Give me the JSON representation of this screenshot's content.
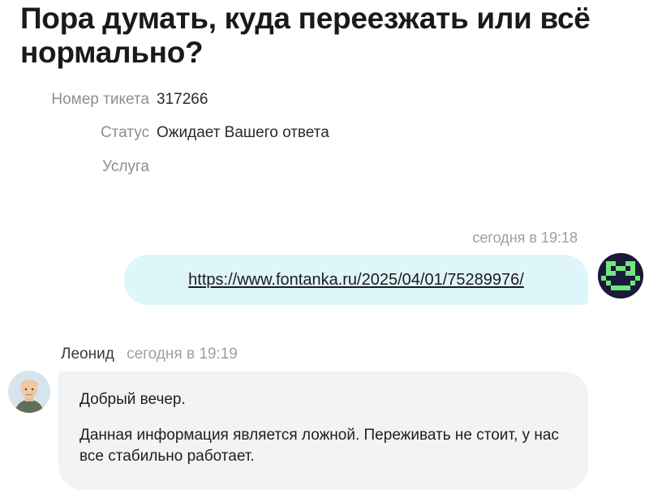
{
  "ticket": {
    "title": "Пора думать, куда переезжать или всё нормально?",
    "number_label": "Номер тикета",
    "number_value": "317266",
    "status_label": "Статус",
    "status_value": "Ожидает Вашего ответа",
    "service_label": "Услуга",
    "service_value": ""
  },
  "messages": {
    "user": {
      "time": "сегодня в 19:18",
      "link": "https://www.fontanka.ru/2025/04/01/75289976/",
      "avatar_icon": "pixel-smiley-icon"
    },
    "agent": {
      "name": "Леонид",
      "time": "сегодня в 19:19",
      "avatar_icon": "agent-avatar-photo",
      "greeting": "Добрый вечер.",
      "body": "Данная информация является ложной. Переживать не стоит, у нас все стабильно работает."
    }
  },
  "colors": {
    "user_bubble": "#def5fa",
    "agent_bubble": "#f2f3f5",
    "bot_avatar_bg": "#1a1a3a",
    "bot_avatar_pixels": "#6ee87a"
  }
}
